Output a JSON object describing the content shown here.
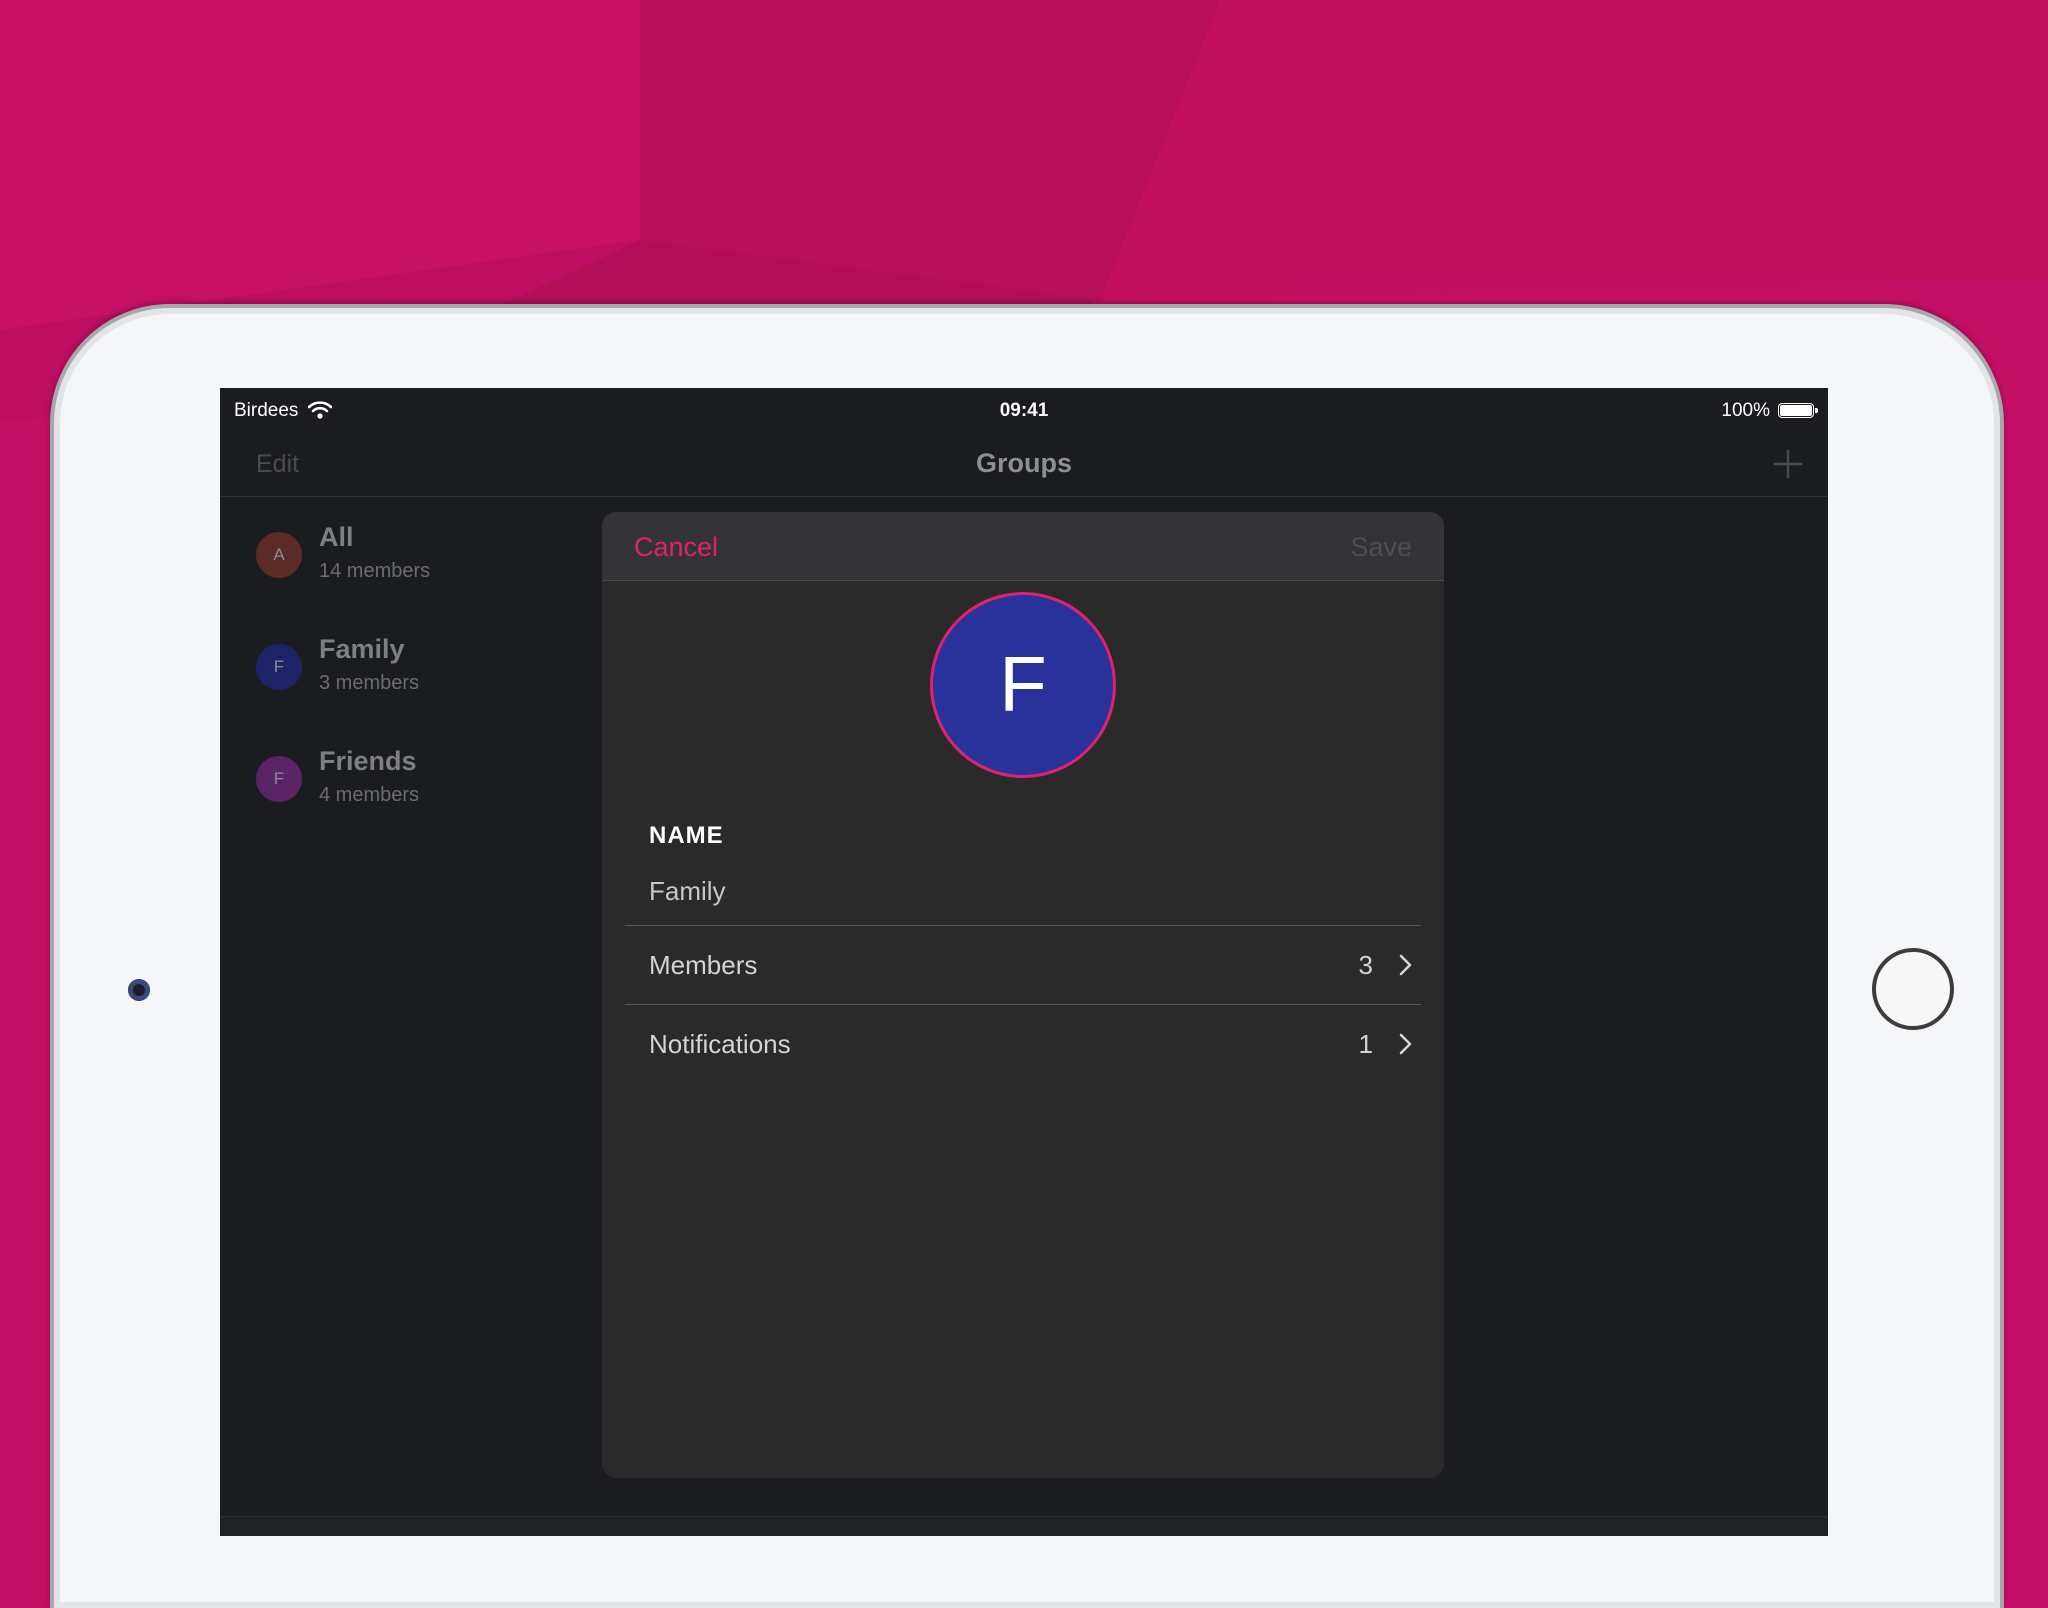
{
  "status_bar": {
    "carrier": "Birdees",
    "time": "09:41",
    "battery": "100%"
  },
  "navbar": {
    "edit_label": "Edit",
    "title": "Groups"
  },
  "groups": [
    {
      "initial": "A",
      "name": "All",
      "members": "14 members",
      "color": "#5d2b26"
    },
    {
      "initial": "F",
      "name": "Family",
      "members": "3 members",
      "color": "#1e2266"
    },
    {
      "initial": "F",
      "name": "Friends",
      "members": "4 members",
      "color": "#5a2466"
    }
  ],
  "modal": {
    "cancel_label": "Cancel",
    "save_label": "Save",
    "avatar_initial": "F",
    "name_label": "NAME",
    "name_value": "Family",
    "rows": [
      {
        "label": "Members",
        "value": "3"
      },
      {
        "label": "Notifications",
        "value": "1"
      }
    ]
  },
  "colors": {
    "accent": "#e0226e",
    "background": "#c50f66",
    "avatar_blue": "#29319b"
  }
}
